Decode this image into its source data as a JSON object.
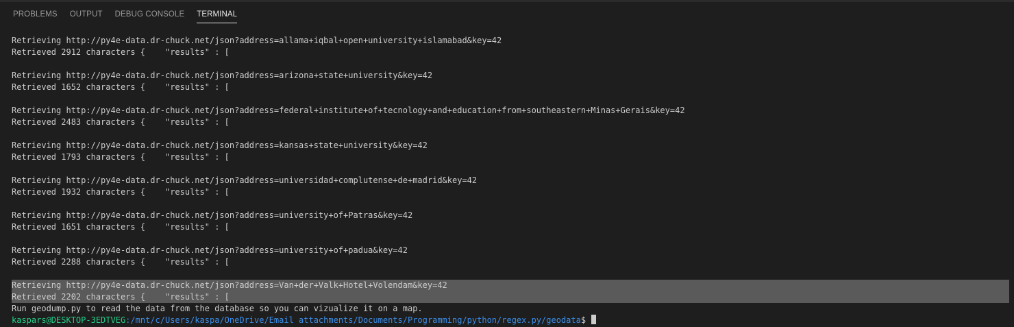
{
  "tabs": [
    {
      "label": "PROBLEMS"
    },
    {
      "label": "OUTPUT"
    },
    {
      "label": "DEBUG CONSOLE"
    },
    {
      "label": "TERMINAL"
    }
  ],
  "terminal": {
    "entries": [
      {
        "retrieving": "Retrieving http://py4e-data.dr-chuck.net/json?address=allama+iqbal+open+university+islamabad&key=42",
        "retrieved": "Retrieved 2912 characters {    \"results\" : ["
      },
      {
        "retrieving": "Retrieving http://py4e-data.dr-chuck.net/json?address=arizona+state+university&key=42",
        "retrieved": "Retrieved 1652 characters {    \"results\" : ["
      },
      {
        "retrieving": "Retrieving http://py4e-data.dr-chuck.net/json?address=federal+institute+of+tecnology+and+education+from+southeastern+Minas+Gerais&key=42",
        "retrieved": "Retrieved 2483 characters {    \"results\" : ["
      },
      {
        "retrieving": "Retrieving http://py4e-data.dr-chuck.net/json?address=kansas+state+university&key=42",
        "retrieved": "Retrieved 1793 characters {    \"results\" : ["
      },
      {
        "retrieving": "Retrieving http://py4e-data.dr-chuck.net/json?address=universidad+complutense+de+madrid&key=42",
        "retrieved": "Retrieved 1932 characters {    \"results\" : ["
      },
      {
        "retrieving": "Retrieving http://py4e-data.dr-chuck.net/json?address=university+of+Patras&key=42",
        "retrieved": "Retrieved 1651 characters {    \"results\" : ["
      },
      {
        "retrieving": "Retrieving http://py4e-data.dr-chuck.net/json?address=university+of+padua&key=42",
        "retrieved": "Retrieved 2288 characters {    \"results\" : ["
      },
      {
        "retrieving": "Retrieving http://py4e-data.dr-chuck.net/json?address=Van+der+Valk+Hotel+Volendam&key=42",
        "retrieved": "Retrieved 2202 characters {    \"results\" : ["
      }
    ],
    "message": "Run geodump.py to read the data from the database so you can vizualize it on a map.",
    "prompt": {
      "user": "kaspars@DESKTOP-3EDTVEG",
      "path": ":/mnt/c/Users/kaspa/OneDrive/Email attachments/Documents/Programming/python/regex.py/geodata",
      "symbol": "$ "
    }
  },
  "colors": {
    "background": "#1e1e1e",
    "text": "#cccccc",
    "prompt_user": "#23d18b",
    "prompt_path": "#3b8eea",
    "selection": "#5a5a5a"
  }
}
